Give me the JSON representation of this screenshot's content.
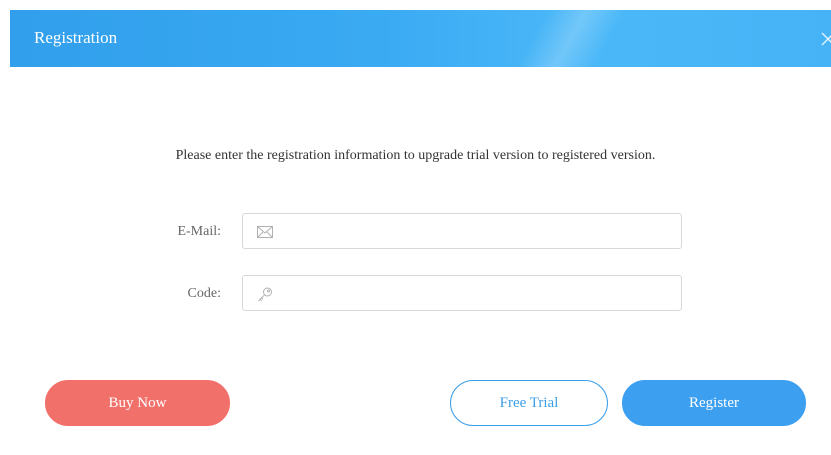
{
  "window": {
    "title": "Registration",
    "close_icon": "close-icon"
  },
  "message": "Please enter the registration information to upgrade trial version to registered version.",
  "form": {
    "email": {
      "label": "E-Mail:",
      "value": "",
      "placeholder": "",
      "icon": "envelope-icon"
    },
    "code": {
      "label": "Code:",
      "value": "",
      "placeholder": "",
      "icon": "key-icon"
    }
  },
  "buttons": {
    "buy_now": "Buy Now",
    "free_trial": "Free Trial",
    "register": "Register"
  },
  "colors": {
    "title_bar": "#3aaaf3",
    "buy_now": "#f2706a",
    "register": "#3d9ff0",
    "free_trial_outline": "#3a9ee8"
  }
}
